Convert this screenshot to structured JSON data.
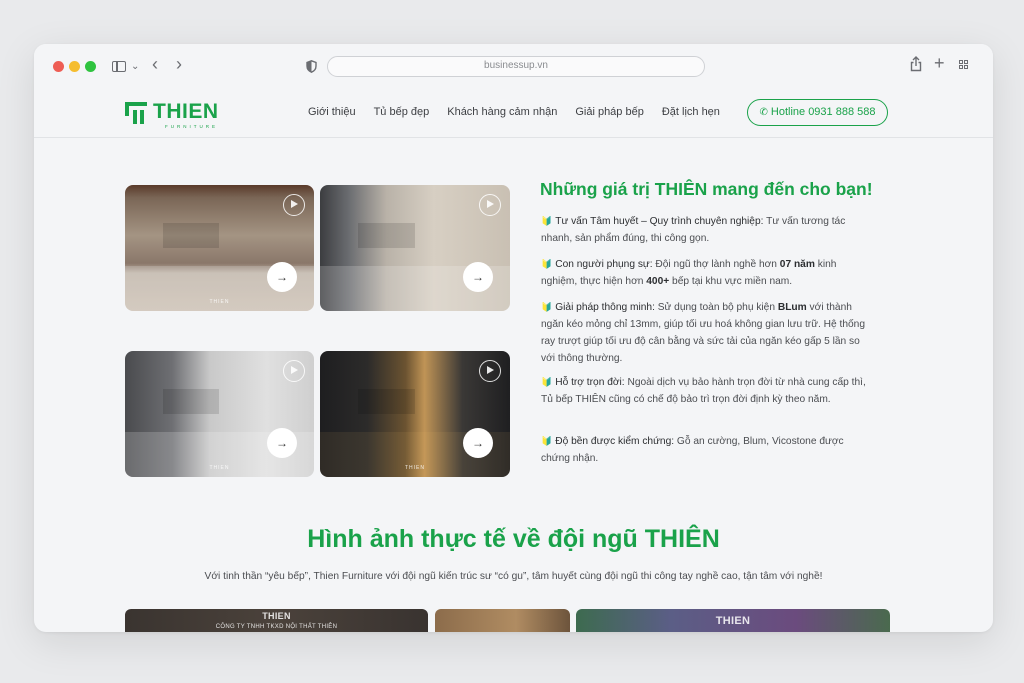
{
  "browser": {
    "url": "businessup.vn"
  },
  "header": {
    "logo_text": "THIEN",
    "logo_sub": "FURNITURE",
    "nav": [
      "Giới thiệu",
      "Tủ bếp đẹp",
      "Khách hàng cảm nhận",
      "Giải pháp bếp",
      "Đặt lịch hẹn"
    ],
    "hotline": "Hotline 0931 888 588"
  },
  "gallery": {
    "watermark": "THIEN",
    "arrow": "→"
  },
  "values": {
    "title": "Những giá trị THIÊN mang đến cho bạn!",
    "items": [
      {
        "head": "Tư vấn Tâm huyết – Quy trình chuyên nghiệp:",
        "body": " Tư vấn tương tác nhanh, sản phẩm đúng, thi công gọn."
      },
      {
        "head": "Con người phụng sự:",
        "body_a": " Đội ngũ thợ lành nghề hơn ",
        "bold_a": "07 năm",
        "body_b": " kinh nghiệm, thực hiện hơn ",
        "bold_b": "400+",
        "body_c": " bếp tại khu vực miền nam."
      },
      {
        "head": "Giải pháp thông minh:",
        "body_a": " Sử dụng toàn bộ phụ kiện ",
        "bold_a": "BLum",
        "body_b": " với thành ngăn kéo mỏng chỉ 13mm, giúp tối ưu hoá không gian lưu trữ. Hệ thống ray trượt giúp tối ưu độ cân bằng và sức tải của ngăn kéo gấp 5 lần so với thông thường."
      },
      {
        "head": "Hỗ trợ trọn đời:",
        "body": " Ngoài dịch vụ bảo hành trọn đời từ nhà cung cấp thì, Tủ bếp THIÊN cũng có chế độ bảo trì trọn đời định kỳ theo năm."
      },
      {
        "head": "Độ bền được kiểm chứng:",
        "body": " Gỗ an cường, Blum, Vicostone được chứng nhận."
      }
    ]
  },
  "team": {
    "title": "Hình ảnh thực tế về đội ngũ THIÊN",
    "subtitle": "Với tinh thần “yêu bếp”, Thien Furniture với đội ngũ kiến trúc sư “có gu”, tâm huyết cùng đội ngũ thi công tay nghề cao, tận tâm với nghề!",
    "photo1_line1": "THIEN",
    "photo1_line2": "CÔNG TY TNHH TKXD NỘI THẤT THIÊN",
    "photo3_line1": "THIEN"
  }
}
